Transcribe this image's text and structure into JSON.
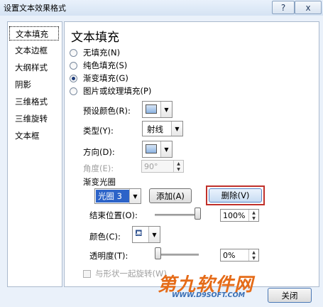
{
  "window": {
    "title": "设置文本效果格式",
    "help_label": "?",
    "close_label": "x"
  },
  "sidebar": {
    "items": [
      {
        "label": "文本填充",
        "selected": true
      },
      {
        "label": "文本边框"
      },
      {
        "label": "大纲样式"
      },
      {
        "label": "阴影"
      },
      {
        "label": "三维格式"
      },
      {
        "label": "三维旋转"
      },
      {
        "label": "文本框"
      }
    ]
  },
  "main": {
    "heading": "文本填充",
    "fill_options": [
      {
        "label": "无填充(N)",
        "selected": false
      },
      {
        "label": "纯色填充(S)",
        "selected": false
      },
      {
        "label": "渐变填充(G)",
        "selected": true
      },
      {
        "label": "图片或纹理填充(P)",
        "selected": false
      }
    ],
    "preset_colors_label": "预设颜色(R):",
    "type_label": "类型(Y):",
    "type_value": "射线",
    "direction_label": "方向(D):",
    "angle_label": "角度(E):",
    "angle_value": "90°",
    "gradient_stops_label": "渐变光圈",
    "stop_select_value": "光圈 3",
    "add_button": "添加(A)",
    "delete_button": "删除(V)",
    "end_position_label": "结束位置(O):",
    "end_position_value": "100%",
    "end_position_level": 1.0,
    "color_label": "颜色(C):",
    "transparency_label": "透明度(T):",
    "transparency_value": "0%",
    "transparency_level": 0.0,
    "rotate_with_shape_label": "与形状一起旋转(W)"
  },
  "footer": {
    "close_button": "关闭"
  },
  "watermark": {
    "brand": "第九软件网",
    "url": "WWW.D9SOFT.COM"
  },
  "colors": {
    "highlight_border": "#c0302a",
    "accent_blue": "#2c63c8"
  }
}
